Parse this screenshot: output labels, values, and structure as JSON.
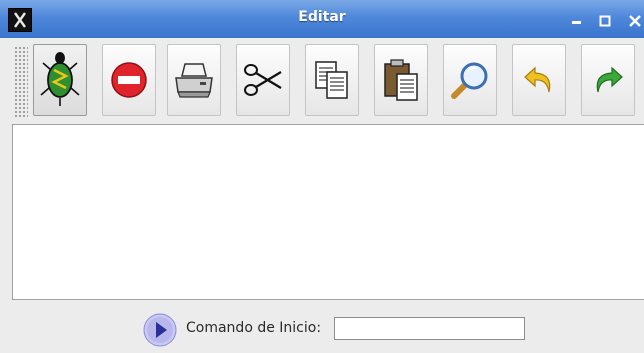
{
  "window": {
    "title": "Editar",
    "controls": [
      "minimize",
      "maximize",
      "close"
    ]
  },
  "toolbar": {
    "buttons": [
      {
        "icon": "turtle-icon",
        "active": true
      },
      {
        "icon": "stop-icon"
      },
      {
        "icon": "printer-icon"
      },
      {
        "icon": "scissors-icon"
      },
      {
        "icon": "copy-icon"
      },
      {
        "icon": "paste-icon"
      },
      {
        "icon": "magnifier-icon"
      },
      {
        "icon": "undo-icon"
      },
      {
        "icon": "redo-icon"
      }
    ]
  },
  "editor": {
    "content": ""
  },
  "bottom": {
    "command_label": "Comando de Inicio:",
    "command_value": ""
  },
  "colors": {
    "titlebar": "#4f88db",
    "stop": "#e0242b",
    "turtle": "#2f8f2f",
    "undo": "#f0c020",
    "redo": "#3aa83a",
    "run": "#2a2f9a"
  }
}
